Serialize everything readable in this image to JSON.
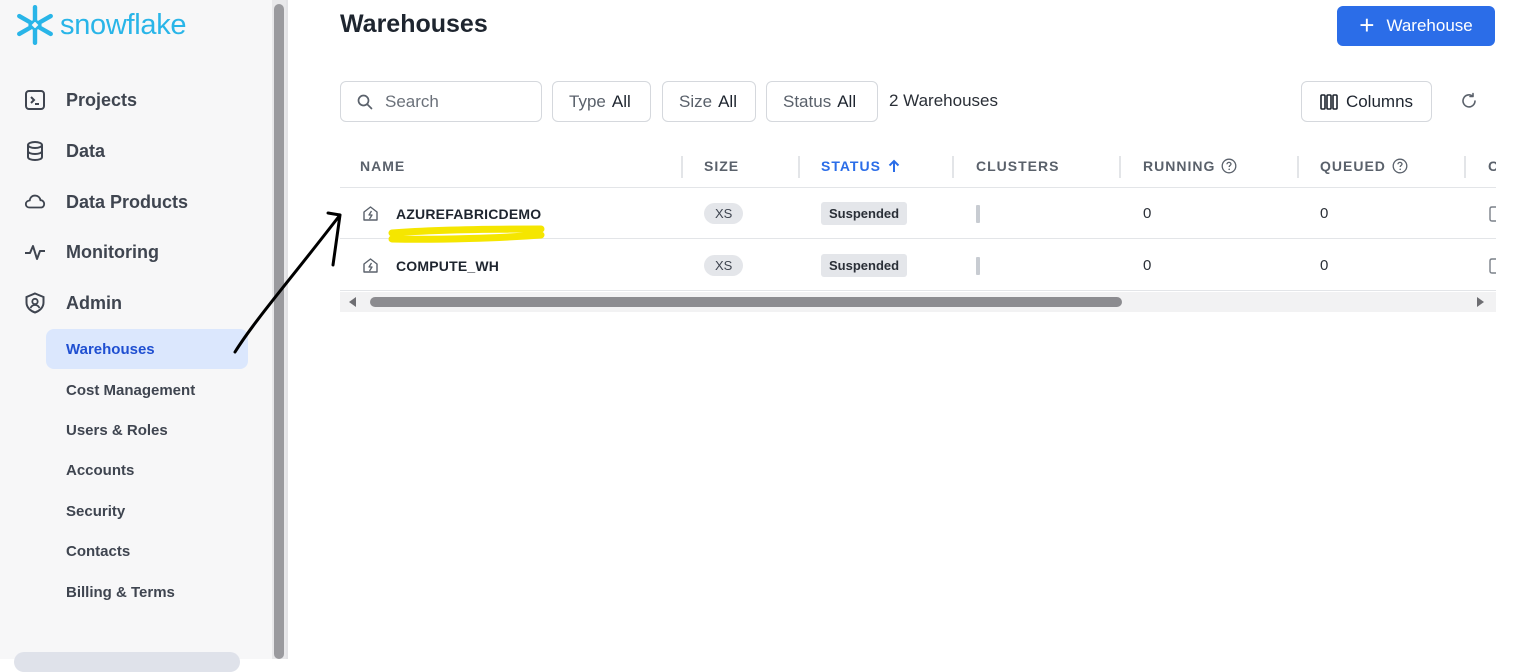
{
  "app": {
    "logo_text": "snowflake",
    "brand_color": "#29b5e8",
    "accent_color": "#2b6de8"
  },
  "sidebar": {
    "nav": [
      {
        "label": "Projects",
        "icon": "terminal-icon"
      },
      {
        "label": "Data",
        "icon": "database-icon"
      },
      {
        "label": "Data Products",
        "icon": "cloud-icon"
      },
      {
        "label": "Monitoring",
        "icon": "activity-icon"
      },
      {
        "label": "Admin",
        "icon": "shield-user-icon"
      }
    ],
    "admin_items": [
      {
        "label": "Warehouses",
        "active": true
      },
      {
        "label": "Cost Management"
      },
      {
        "label": "Users & Roles"
      },
      {
        "label": "Accounts"
      },
      {
        "label": "Security"
      },
      {
        "label": "Contacts"
      },
      {
        "label": "Billing & Terms"
      }
    ]
  },
  "main": {
    "title": "Warehouses",
    "add_button": {
      "plus": "+",
      "label": "Warehouse"
    },
    "search_placeholder": "Search",
    "filters": [
      {
        "key": "Type",
        "value": "All"
      },
      {
        "key": "Size",
        "value": "All"
      },
      {
        "key": "Status",
        "value": "All"
      }
    ],
    "count_text": "2 Warehouses",
    "columns_label": "Columns"
  },
  "table": {
    "headers": [
      "NAME",
      "SIZE",
      "STATUS",
      "CLUSTERS",
      "RUNNING",
      "QUEUED",
      "C"
    ],
    "sorted_column": "STATUS",
    "rows": [
      {
        "name": "AZUREFABRICDEMO",
        "size": "XS",
        "status": "Suspended",
        "running": "0",
        "queued": "0"
      },
      {
        "name": "COMPUTE_WH",
        "size": "XS",
        "status": "Suspended",
        "running": "0",
        "queued": "0"
      }
    ]
  },
  "annotation": {
    "highlight_color": "#f5e600",
    "arrow_color": "#000000"
  }
}
